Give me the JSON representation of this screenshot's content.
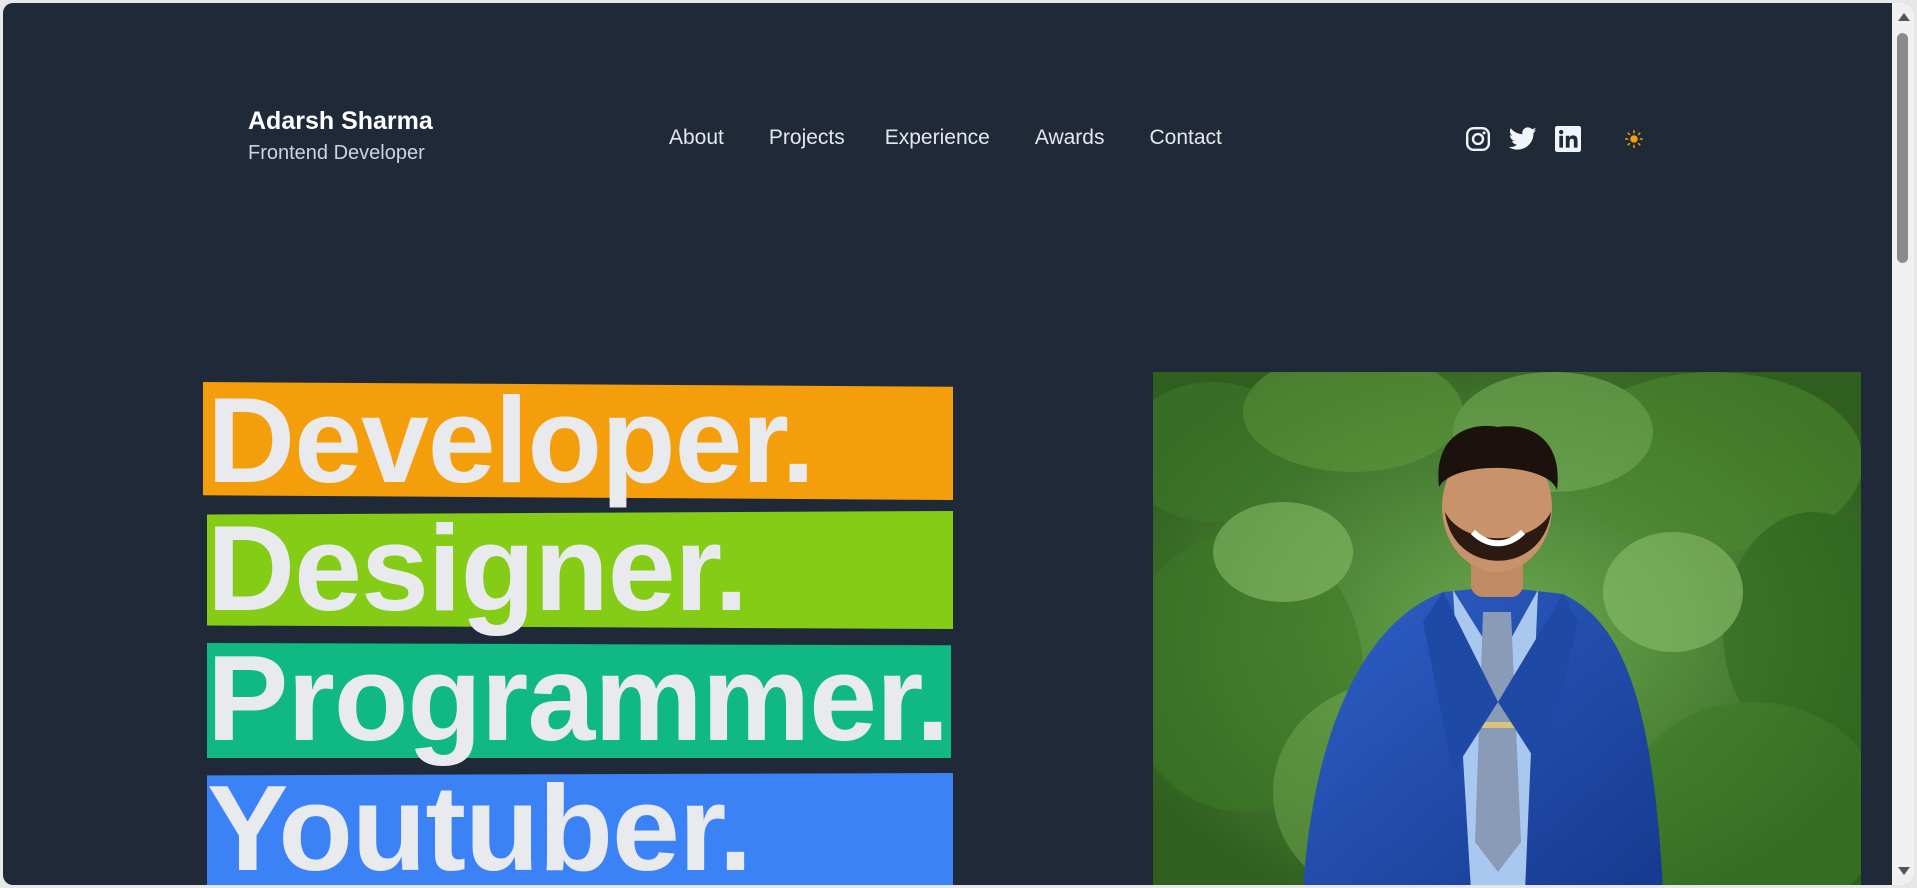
{
  "header": {
    "name": "Adarsh Sharma",
    "role": "Frontend Developer"
  },
  "nav": {
    "items": [
      "About",
      "Projects",
      "Experience",
      "Awards",
      "Contact"
    ]
  },
  "social": {
    "icons": [
      "instagram-icon",
      "twitter-icon",
      "linkedin-icon"
    ],
    "theme_icon": "sun-icon",
    "theme_color": "#f59e0b"
  },
  "hero": {
    "words": [
      "Developer.",
      "Designer.",
      "Programmer.",
      "Youtuber."
    ],
    "band_colors": [
      "#f59e0b",
      "#84cc16",
      "#10b981",
      "#3b82f6"
    ]
  },
  "colors": {
    "background": "#1f2937",
    "text": "#e8eaee"
  }
}
